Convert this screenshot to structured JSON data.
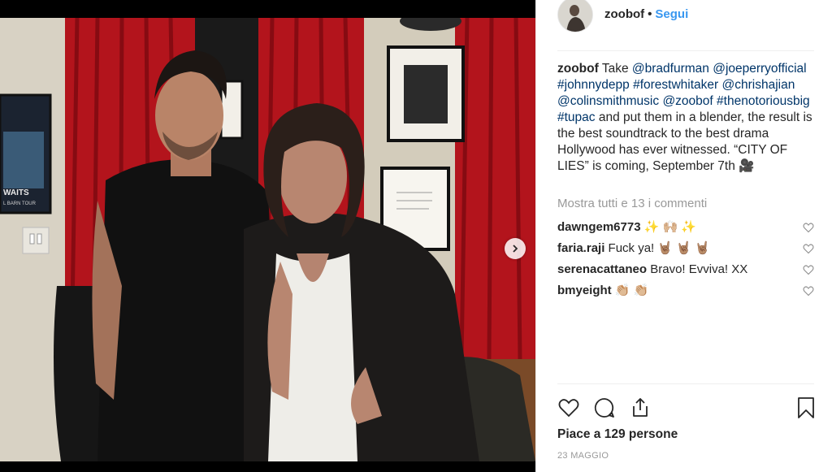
{
  "header": {
    "username": "zoobof",
    "separator": "•",
    "follow_label": "Segui"
  },
  "caption": {
    "username": "zoobof",
    "segments": [
      {
        "type": "text",
        "value": "Take "
      },
      {
        "type": "tag",
        "value": "@bradfurman"
      },
      {
        "type": "text",
        "value": " "
      },
      {
        "type": "tag",
        "value": "@joeperryofficial"
      },
      {
        "type": "text",
        "value": " "
      },
      {
        "type": "tag",
        "value": "#johnnydepp"
      },
      {
        "type": "text",
        "value": " "
      },
      {
        "type": "tag",
        "value": "#forestwhitaker"
      },
      {
        "type": "text",
        "value": " "
      },
      {
        "type": "tag",
        "value": "@chrishajian"
      },
      {
        "type": "text",
        "value": " "
      },
      {
        "type": "tag",
        "value": "@colinsmithmusic"
      },
      {
        "type": "text",
        "value": " "
      },
      {
        "type": "tag",
        "value": "@zoobof"
      },
      {
        "type": "text",
        "value": " "
      },
      {
        "type": "tag",
        "value": "#thenotoriousbig"
      },
      {
        "type": "text",
        "value": " "
      },
      {
        "type": "tag",
        "value": "#tupac"
      },
      {
        "type": "text",
        "value": " and put them in a blender, the result is the best soundtrack to the best drama Hollywood has ever witnessed. “CITY OF LIES” is coming, September 7th 🎥"
      }
    ]
  },
  "view_all_comments": "Mostra tutti e 13 i commenti",
  "comments": [
    {
      "user": "dawngem6773",
      "text": "✨ 🙌🏼 ✨"
    },
    {
      "user": "faria.raji",
      "text": "Fuck ya! 🤘🏽 🤘🏽 🤘🏽"
    },
    {
      "user": "serenacattaneo",
      "text": "Bravo! Evviva! XX"
    },
    {
      "user": "bmyeight",
      "text": "👏🏼 👏🏼"
    }
  ],
  "likes_text": "Piace a 129 persone",
  "date": "23 MAGGIO",
  "poster": {
    "text_line1": "WAITS",
    "text_line2": "L BARN TOUR"
  },
  "colors": {
    "link": "#003569",
    "follow": "#3897f0",
    "muted": "#999999",
    "curtain": "#b3141c"
  },
  "icons": [
    "heart-icon",
    "comment-icon",
    "share-icon",
    "bookmark-icon",
    "chevron-right-icon",
    "heart-outline-small-icon"
  ]
}
